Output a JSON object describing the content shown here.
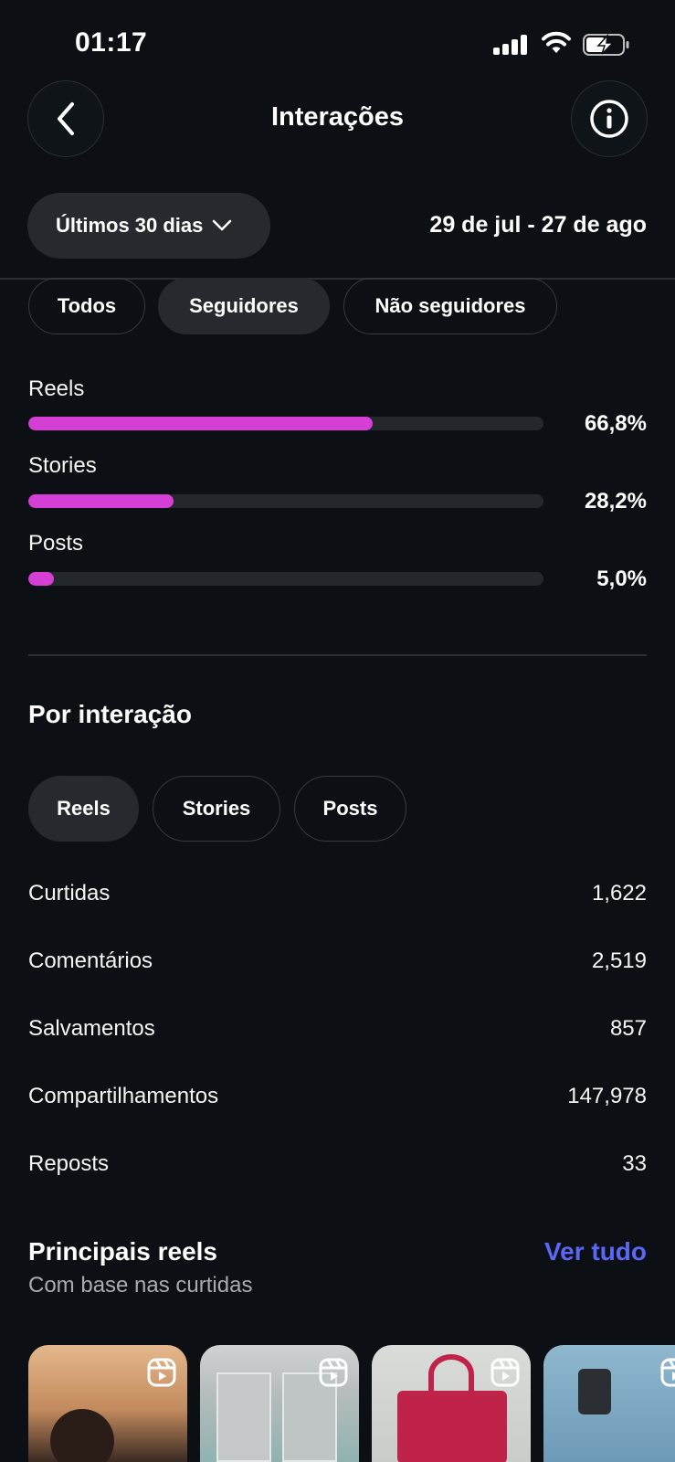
{
  "status_bar": {
    "time": "01:17"
  },
  "header": {
    "title": "Interações"
  },
  "period": {
    "label": "Últimos 30 dias",
    "date_range": "29 de jul - 27 de ago"
  },
  "audience_filters": [
    {
      "label": "Todos",
      "active": false
    },
    {
      "label": "Seguidores",
      "active": true
    },
    {
      "label": "Não seguidores",
      "active": false
    }
  ],
  "content_breakdown": [
    {
      "label": "Reels",
      "value": "66,8%",
      "fraction": 0.668
    },
    {
      "label": "Stories",
      "value": "28,2%",
      "fraction": 0.282
    },
    {
      "label": "Posts",
      "value": "5,0%",
      "fraction": 0.05
    }
  ],
  "by_interaction": {
    "title": "Por interação",
    "tabs": [
      {
        "label": "Reels",
        "active": true
      },
      {
        "label": "Stories",
        "active": false
      },
      {
        "label": "Posts",
        "active": false
      }
    ],
    "metrics": [
      {
        "label": "Curtidas",
        "value": "1,622"
      },
      {
        "label": "Comentários",
        "value": "2,519"
      },
      {
        "label": "Salvamentos",
        "value": "857"
      },
      {
        "label": "Compartilhamentos",
        "value": "147,978"
      },
      {
        "label": "Reposts",
        "value": "33"
      }
    ]
  },
  "top_reels": {
    "title": "Principais reels",
    "see_all": "Ver tudo",
    "subtitle": "Com base nas curtidas"
  },
  "colors": {
    "background": "#0c1014",
    "bar_fill": "#d63fd6",
    "link": "#5b67f5"
  }
}
